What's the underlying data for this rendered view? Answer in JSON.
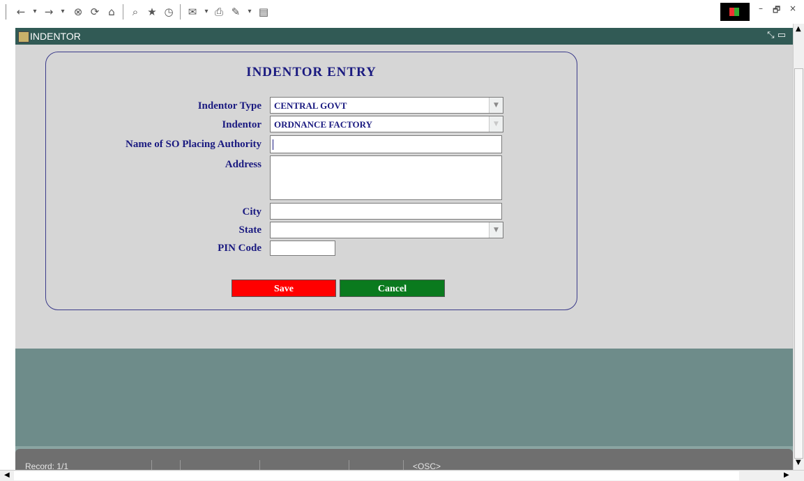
{
  "toolbar": {
    "icons": [
      "back-icon",
      "dropdown-icon",
      "forward-icon",
      "dropdown-icon",
      "stop-icon",
      "refresh-icon",
      "home-icon",
      "search-icon",
      "favorites-icon",
      "history-icon",
      "mail-icon",
      "print-icon",
      "edit-icon",
      "dropdown-icon",
      "discuss-icon"
    ],
    "glyphs": {
      "back": "←",
      "drop": "▾",
      "forward": "→",
      "stop": "⊗",
      "refresh": "⟳",
      "home": "⌂",
      "search": "⌕",
      "favorites": "★",
      "history": "◷",
      "mail": "✉",
      "print": "⎙",
      "edit": "✎",
      "discuss": "▤"
    }
  },
  "window": {
    "title": "INDENTOR",
    "controls": {
      "minimize": "–",
      "restore": "🗗",
      "close": "×"
    }
  },
  "form": {
    "heading": "INDENTOR ENTRY",
    "labels": {
      "indentor_type": "Indentor Type",
      "indentor": "Indentor",
      "so_authority": "Name of SO Placing Authority",
      "address": "Address",
      "city": "City",
      "state": "State",
      "pin": "PIN Code"
    },
    "values": {
      "indentor_type": "CENTRAL GOVT",
      "indentor": "ORDNANCE FACTORY",
      "so_authority": "",
      "address": "",
      "city": "",
      "state": "",
      "pin": ""
    },
    "buttons": {
      "save": "Save",
      "cancel": "Cancel"
    }
  },
  "status": {
    "record": "Record: 1/1",
    "mode": "<OSC>"
  },
  "colors": {
    "label": "#1a1a80",
    "save": "#ff0000",
    "cancel": "#0a7a1e",
    "titlebar": "#315a55",
    "background": "#6e8c8a"
  }
}
